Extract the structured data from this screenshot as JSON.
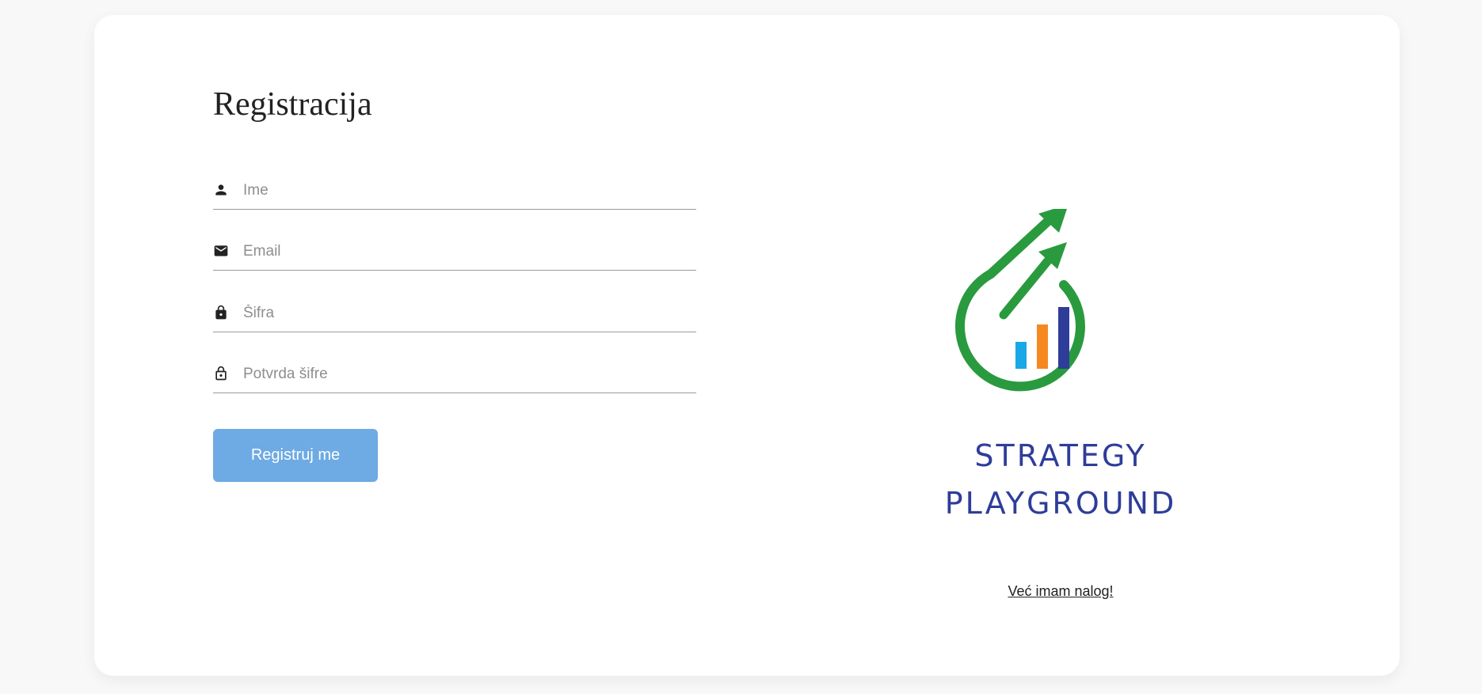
{
  "form": {
    "title": "Registracija",
    "fields": [
      {
        "icon": "person-icon",
        "placeholder": "Ime",
        "value": ""
      },
      {
        "icon": "mail-icon",
        "placeholder": "Email",
        "value": ""
      },
      {
        "icon": "lock-icon",
        "placeholder": "Šifra",
        "value": ""
      },
      {
        "icon": "lock-outline-icon",
        "placeholder": "Potvrda šifre",
        "value": ""
      }
    ],
    "submit_label": "Registruj me"
  },
  "brand": {
    "line1": "STRATEGY",
    "line2": "PLAYGROUND",
    "colors": {
      "green": "#2a9a3e",
      "blue_bar": "#18a8e6",
      "orange_bar": "#f5891f",
      "navy_bar": "#2e3d99",
      "text": "#2e3d99"
    }
  },
  "login_link": "Već imam nalog!",
  "colors": {
    "button": "#6eaae4",
    "background": "#f8f8f8",
    "card": "#ffffff"
  }
}
